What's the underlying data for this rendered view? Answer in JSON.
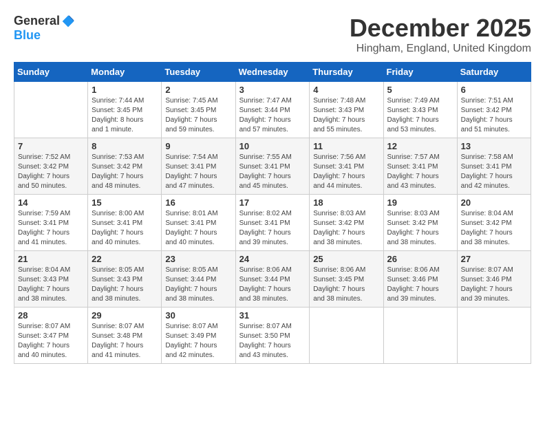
{
  "logo": {
    "general": "General",
    "blue": "Blue"
  },
  "title": "December 2025",
  "location": "Hingham, England, United Kingdom",
  "days_of_week": [
    "Sunday",
    "Monday",
    "Tuesday",
    "Wednesday",
    "Thursday",
    "Friday",
    "Saturday"
  ],
  "weeks": [
    [
      {
        "day": "",
        "info": ""
      },
      {
        "day": "1",
        "info": "Sunrise: 7:44 AM\nSunset: 3:45 PM\nDaylight: 8 hours\nand 1 minute."
      },
      {
        "day": "2",
        "info": "Sunrise: 7:45 AM\nSunset: 3:45 PM\nDaylight: 7 hours\nand 59 minutes."
      },
      {
        "day": "3",
        "info": "Sunrise: 7:47 AM\nSunset: 3:44 PM\nDaylight: 7 hours\nand 57 minutes."
      },
      {
        "day": "4",
        "info": "Sunrise: 7:48 AM\nSunset: 3:43 PM\nDaylight: 7 hours\nand 55 minutes."
      },
      {
        "day": "5",
        "info": "Sunrise: 7:49 AM\nSunset: 3:43 PM\nDaylight: 7 hours\nand 53 minutes."
      },
      {
        "day": "6",
        "info": "Sunrise: 7:51 AM\nSunset: 3:42 PM\nDaylight: 7 hours\nand 51 minutes."
      }
    ],
    [
      {
        "day": "7",
        "info": "Sunrise: 7:52 AM\nSunset: 3:42 PM\nDaylight: 7 hours\nand 50 minutes."
      },
      {
        "day": "8",
        "info": "Sunrise: 7:53 AM\nSunset: 3:42 PM\nDaylight: 7 hours\nand 48 minutes."
      },
      {
        "day": "9",
        "info": "Sunrise: 7:54 AM\nSunset: 3:41 PM\nDaylight: 7 hours\nand 47 minutes."
      },
      {
        "day": "10",
        "info": "Sunrise: 7:55 AM\nSunset: 3:41 PM\nDaylight: 7 hours\nand 45 minutes."
      },
      {
        "day": "11",
        "info": "Sunrise: 7:56 AM\nSunset: 3:41 PM\nDaylight: 7 hours\nand 44 minutes."
      },
      {
        "day": "12",
        "info": "Sunrise: 7:57 AM\nSunset: 3:41 PM\nDaylight: 7 hours\nand 43 minutes."
      },
      {
        "day": "13",
        "info": "Sunrise: 7:58 AM\nSunset: 3:41 PM\nDaylight: 7 hours\nand 42 minutes."
      }
    ],
    [
      {
        "day": "14",
        "info": "Sunrise: 7:59 AM\nSunset: 3:41 PM\nDaylight: 7 hours\nand 41 minutes."
      },
      {
        "day": "15",
        "info": "Sunrise: 8:00 AM\nSunset: 3:41 PM\nDaylight: 7 hours\nand 40 minutes."
      },
      {
        "day": "16",
        "info": "Sunrise: 8:01 AM\nSunset: 3:41 PM\nDaylight: 7 hours\nand 40 minutes."
      },
      {
        "day": "17",
        "info": "Sunrise: 8:02 AM\nSunset: 3:41 PM\nDaylight: 7 hours\nand 39 minutes."
      },
      {
        "day": "18",
        "info": "Sunrise: 8:03 AM\nSunset: 3:42 PM\nDaylight: 7 hours\nand 38 minutes."
      },
      {
        "day": "19",
        "info": "Sunrise: 8:03 AM\nSunset: 3:42 PM\nDaylight: 7 hours\nand 38 minutes."
      },
      {
        "day": "20",
        "info": "Sunrise: 8:04 AM\nSunset: 3:42 PM\nDaylight: 7 hours\nand 38 minutes."
      }
    ],
    [
      {
        "day": "21",
        "info": "Sunrise: 8:04 AM\nSunset: 3:43 PM\nDaylight: 7 hours\nand 38 minutes."
      },
      {
        "day": "22",
        "info": "Sunrise: 8:05 AM\nSunset: 3:43 PM\nDaylight: 7 hours\nand 38 minutes."
      },
      {
        "day": "23",
        "info": "Sunrise: 8:05 AM\nSunset: 3:44 PM\nDaylight: 7 hours\nand 38 minutes."
      },
      {
        "day": "24",
        "info": "Sunrise: 8:06 AM\nSunset: 3:44 PM\nDaylight: 7 hours\nand 38 minutes."
      },
      {
        "day": "25",
        "info": "Sunrise: 8:06 AM\nSunset: 3:45 PM\nDaylight: 7 hours\nand 38 minutes."
      },
      {
        "day": "26",
        "info": "Sunrise: 8:06 AM\nSunset: 3:46 PM\nDaylight: 7 hours\nand 39 minutes."
      },
      {
        "day": "27",
        "info": "Sunrise: 8:07 AM\nSunset: 3:46 PM\nDaylight: 7 hours\nand 39 minutes."
      }
    ],
    [
      {
        "day": "28",
        "info": "Sunrise: 8:07 AM\nSunset: 3:47 PM\nDaylight: 7 hours\nand 40 minutes."
      },
      {
        "day": "29",
        "info": "Sunrise: 8:07 AM\nSunset: 3:48 PM\nDaylight: 7 hours\nand 41 minutes."
      },
      {
        "day": "30",
        "info": "Sunrise: 8:07 AM\nSunset: 3:49 PM\nDaylight: 7 hours\nand 42 minutes."
      },
      {
        "day": "31",
        "info": "Sunrise: 8:07 AM\nSunset: 3:50 PM\nDaylight: 7 hours\nand 43 minutes."
      },
      {
        "day": "",
        "info": ""
      },
      {
        "day": "",
        "info": ""
      },
      {
        "day": "",
        "info": ""
      }
    ]
  ]
}
